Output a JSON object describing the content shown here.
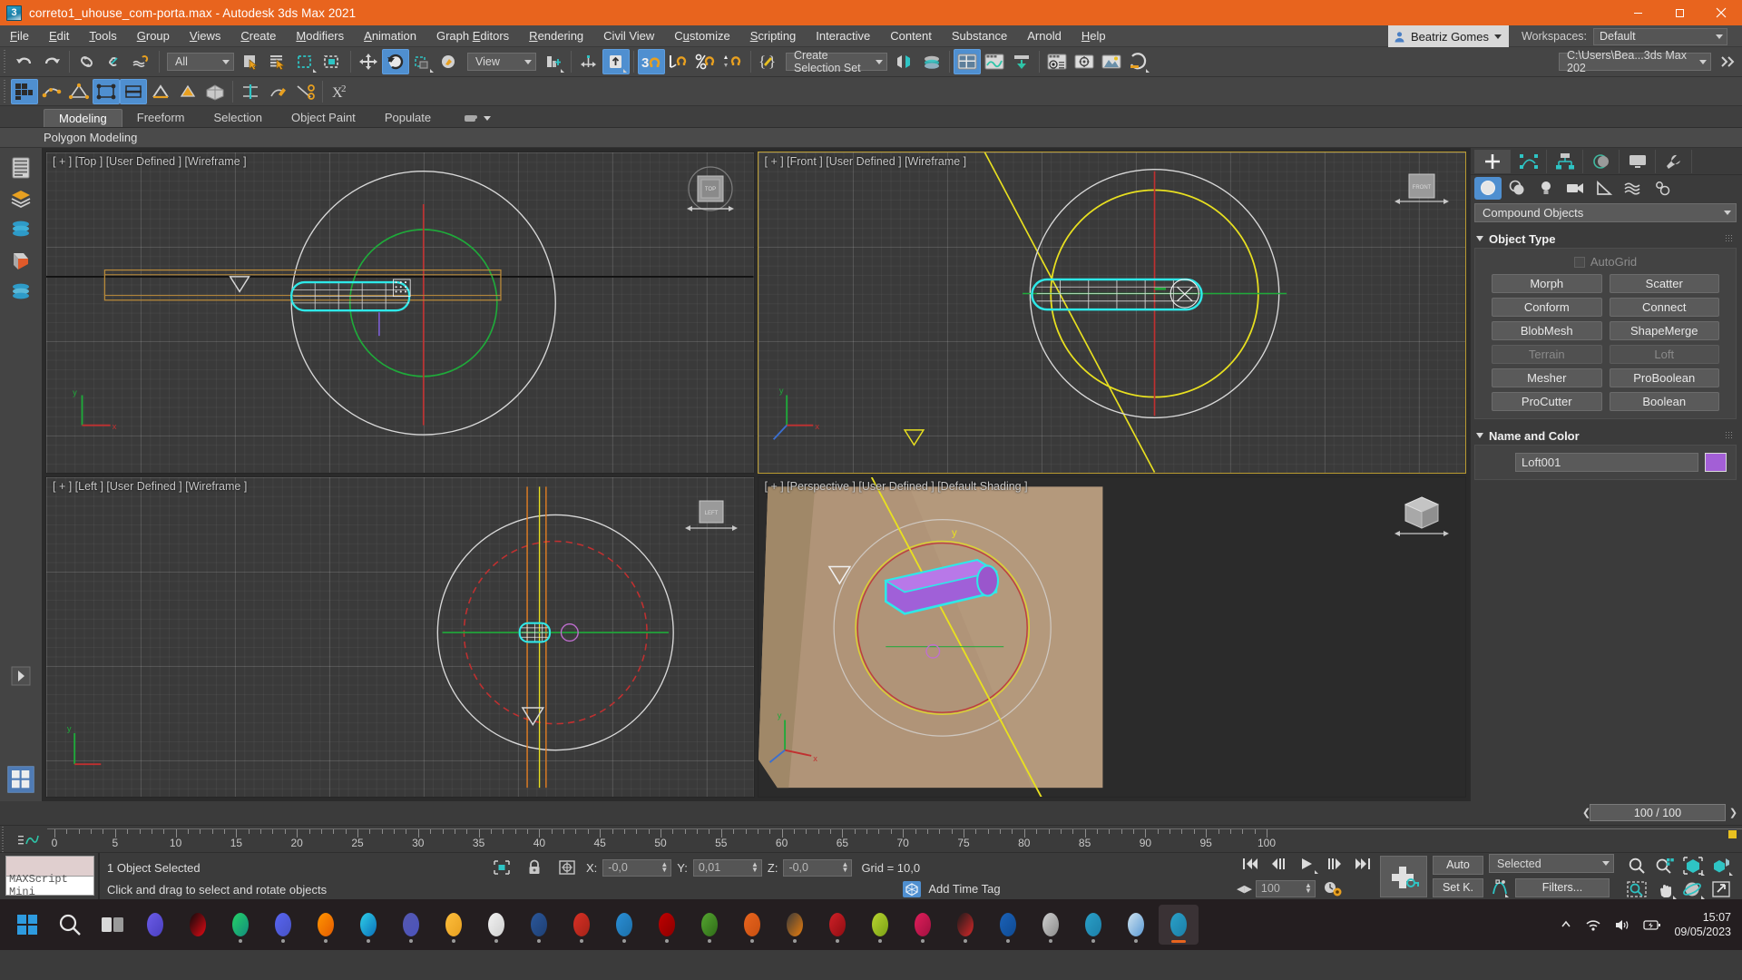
{
  "titlebar": {
    "title": "correto1_uhouse_com-porta.max - Autodesk 3ds Max 2021",
    "app_icon": "3dsmax-icon",
    "minimize": "minimize-button",
    "maximize": "maximize-button",
    "close": "close-button"
  },
  "menubar": {
    "items": [
      {
        "label": "File",
        "accel": "F"
      },
      {
        "label": "Edit",
        "accel": "E"
      },
      {
        "label": "Tools",
        "accel": "T"
      },
      {
        "label": "Group",
        "accel": "G"
      },
      {
        "label": "Views",
        "accel": "V"
      },
      {
        "label": "Create",
        "accel": "C"
      },
      {
        "label": "Modifiers",
        "accel": "M"
      },
      {
        "label": "Animation",
        "accel": "A"
      },
      {
        "label": "Graph Editors",
        "accel": "E"
      },
      {
        "label": "Rendering",
        "accel": "R"
      },
      {
        "label": "Civil View",
        "accel": ""
      },
      {
        "label": "Customize",
        "accel": "u"
      },
      {
        "label": "Scripting",
        "accel": "S"
      },
      {
        "label": "Interactive",
        "accel": ""
      },
      {
        "label": "Content",
        "accel": ""
      },
      {
        "label": "Substance",
        "accel": ""
      },
      {
        "label": "Arnold",
        "accel": ""
      },
      {
        "label": "Help",
        "accel": "H"
      }
    ],
    "user_name": "Beatriz Gomes",
    "workspaces_label": "Workspaces:",
    "workspace_value": "Default"
  },
  "toolbar": {
    "selection_filter": "All",
    "reference_coord": "View",
    "selection_set": "Create Selection Set",
    "project_path": "C:\\Users\\Bea...3ds Max 202",
    "buttons": [
      "undo-button",
      "redo-button",
      "select-link-button",
      "unlink-button",
      "bind-space-warp-button",
      "select-object-button",
      "select-by-name-button",
      "rectangular-selection-region-button",
      "window-crossing-button",
      "select-and-move-button",
      "select-and-rotate-button",
      "select-and-scale-button",
      "placement-tool-button",
      "mirror-button",
      "align-button",
      "named-selection-sets-button",
      "snaps-toggle-button",
      "angle-snap-toggle-button",
      "percent-snap-toggle-button",
      "spinner-snap-toggle-button",
      "edit-named-selection-sets-button",
      "manage-layers-button",
      "toggle-scene-explorer-button",
      "curve-editor-button",
      "schematic-view-button",
      "material-editor-button",
      "render-setup-button",
      "rendered-frame-window-button",
      "render-production-button"
    ]
  },
  "ribbon": {
    "tabs": [
      "Modeling",
      "Freeform",
      "Selection",
      "Object Paint",
      "Populate"
    ],
    "active_tab": "Modeling",
    "subtitle": "Polygon Modeling"
  },
  "viewports": [
    {
      "id": "top",
      "label": "[ + ] [Top ] [User Defined ] [Wireframe ]",
      "cube": "TOP",
      "active": false
    },
    {
      "id": "front",
      "label": "[ + ] [Front ] [User Defined ] [Wireframe ]",
      "cube": "FRONT",
      "active": true
    },
    {
      "id": "left",
      "label": "[ + ] [Left ] [User Defined ] [Wireframe ]",
      "cube": "LEFT",
      "active": false
    },
    {
      "id": "perspective",
      "label": "[ + ] [Perspective ] [User Defined ] [Default Shading ]",
      "cube": "",
      "active": false
    }
  ],
  "command_panel": {
    "tabs": [
      "create-tab",
      "modify-tab",
      "hierarchy-tab",
      "motion-tab",
      "display-tab",
      "utilities-tab"
    ],
    "subtabs": [
      "geometry-subtab",
      "shapes-subtab",
      "lights-subtab",
      "cameras-subtab",
      "helpers-subtab",
      "space-warps-subtab",
      "systems-subtab"
    ],
    "category": "Compound Objects",
    "object_type": {
      "title": "Object Type",
      "autogrid_label": "AutoGrid",
      "buttons": [
        {
          "label": "Morph",
          "disabled": false
        },
        {
          "label": "Scatter",
          "disabled": false
        },
        {
          "label": "Conform",
          "disabled": false
        },
        {
          "label": "Connect",
          "disabled": false
        },
        {
          "label": "BlobMesh",
          "disabled": false
        },
        {
          "label": "ShapeMerge",
          "disabled": false
        },
        {
          "label": "Terrain",
          "disabled": true
        },
        {
          "label": "Loft",
          "disabled": true
        },
        {
          "label": "Mesher",
          "disabled": false
        },
        {
          "label": "ProBoolean",
          "disabled": false
        },
        {
          "label": "ProCutter",
          "disabled": false
        },
        {
          "label": "Boolean",
          "disabled": false
        }
      ]
    },
    "name_and_color": {
      "title": "Name and Color",
      "name": "Loft001",
      "color": "#a35fd6"
    }
  },
  "timeline": {
    "frame_display": "100 / 100",
    "ruler_ticks": [
      0,
      5,
      10,
      15,
      20,
      25,
      30,
      35,
      40,
      45,
      50,
      55,
      60,
      65,
      70,
      75,
      80,
      85,
      90,
      95,
      100
    ],
    "ruler_max": 100
  },
  "statusbar": {
    "maxscript_label": "MAXScript Mini",
    "selection_status": "1 Object Selected",
    "prompt": "Click and drag to select and rotate objects",
    "x_label": "X:",
    "x_value": "-0,0",
    "y_label": "Y:",
    "y_value": "0,01",
    "z_label": "Z:",
    "z_value": "-0,0",
    "grid_label": "Grid = 10,0",
    "add_time_tag": "Add Time Tag",
    "current_frame": "100",
    "auto_key": "Auto",
    "set_key": "Set K.",
    "key_filter_selected": "Selected",
    "filters_button": "Filters...",
    "icons": {
      "selection_lock": "selection-lock-icon",
      "isolate": "isolate-selection-icon",
      "absolute_mode": "absolute-mode-transform-icon"
    }
  },
  "navigation": {
    "buttons": [
      "zoom-button",
      "zoom-all-button",
      "zoom-extents-button",
      "zoom-region-button",
      "field-of-view-button",
      "pan-view-button",
      "orbit-button",
      "maximize-viewport-button"
    ]
  },
  "taskbar": {
    "apps": [
      {
        "name": "start-windows",
        "color1": "#2e9bdf",
        "color2": "#2e9bdf"
      },
      {
        "name": "search",
        "color1": "#e8e8e8",
        "color2": "#c8c8c8"
      },
      {
        "name": "task-view",
        "color1": "#d8d8d8",
        "color2": "#9a9a9a"
      },
      {
        "name": "widgets",
        "color1": "#6b5ce7",
        "color2": "#4a3fc0"
      },
      {
        "name": "netflix",
        "color1": "#0b0b0b",
        "color2": "#e50914"
      },
      {
        "name": "whatsapp",
        "color1": "#25d366",
        "color2": "#128c7e"
      },
      {
        "name": "discord",
        "color1": "#5865f2",
        "color2": "#4752c4"
      },
      {
        "name": "firefox",
        "color1": "#ff9500",
        "color2": "#e55b00"
      },
      {
        "name": "edge",
        "color1": "#2ecfe8",
        "color2": "#0b70b9"
      },
      {
        "name": "teams",
        "color1": "#5558af",
        "color2": "#4b53bc"
      },
      {
        "name": "file-explorer",
        "color1": "#fdbe3c",
        "color2": "#e8a020"
      },
      {
        "name": "notepad",
        "color1": "#f2f2f2",
        "color2": "#cfcfcf"
      },
      {
        "name": "word",
        "color1": "#2b579a",
        "color2": "#1e3f73"
      },
      {
        "name": "excel",
        "color1": "#d93025",
        "color2": "#a32318"
      },
      {
        "name": "vscode",
        "color1": "#2a8fd6",
        "color2": "#1c6fa8"
      },
      {
        "name": "filezilla",
        "color1": "#bf0000",
        "color2": "#8b0000"
      },
      {
        "name": "qbittorrent",
        "color1": "#55a630",
        "color2": "#2f6b18"
      },
      {
        "name": "office",
        "color1": "#e8651e",
        "color2": "#c94f10"
      },
      {
        "name": "blender",
        "color1": "#3a3a3a",
        "color2": "#e87d0d"
      },
      {
        "name": "acrobat",
        "color1": "#cf2027",
        "color2": "#8e0d12"
      },
      {
        "name": "sketchup",
        "color1": "#b8d430",
        "color2": "#7aa115"
      },
      {
        "name": "autocad",
        "color1": "#e01e5a",
        "color2": "#a01040"
      },
      {
        "name": "revit-r",
        "color1": "#1b1b1b",
        "color2": "#d62728"
      },
      {
        "name": "revit",
        "color1": "#1b62b8",
        "color2": "#0f4a92"
      },
      {
        "name": "rhino",
        "color1": "#cfcfcf",
        "color2": "#8b8b8b"
      },
      {
        "name": "3dsmax-1",
        "color1": "#2aa0c8",
        "color2": "#1c7fa8"
      },
      {
        "name": "lumion",
        "color1": "#cfe3f0",
        "color2": "#5b9ad5"
      },
      {
        "name": "3dsmax-active",
        "color1": "#2aa0c8",
        "color2": "#1c7fa8"
      }
    ],
    "tray": [
      "show-hidden-icons",
      "wifi-icon",
      "volume-icon",
      "battery-icon"
    ],
    "time": "15:07",
    "date": "09/05/2023"
  }
}
